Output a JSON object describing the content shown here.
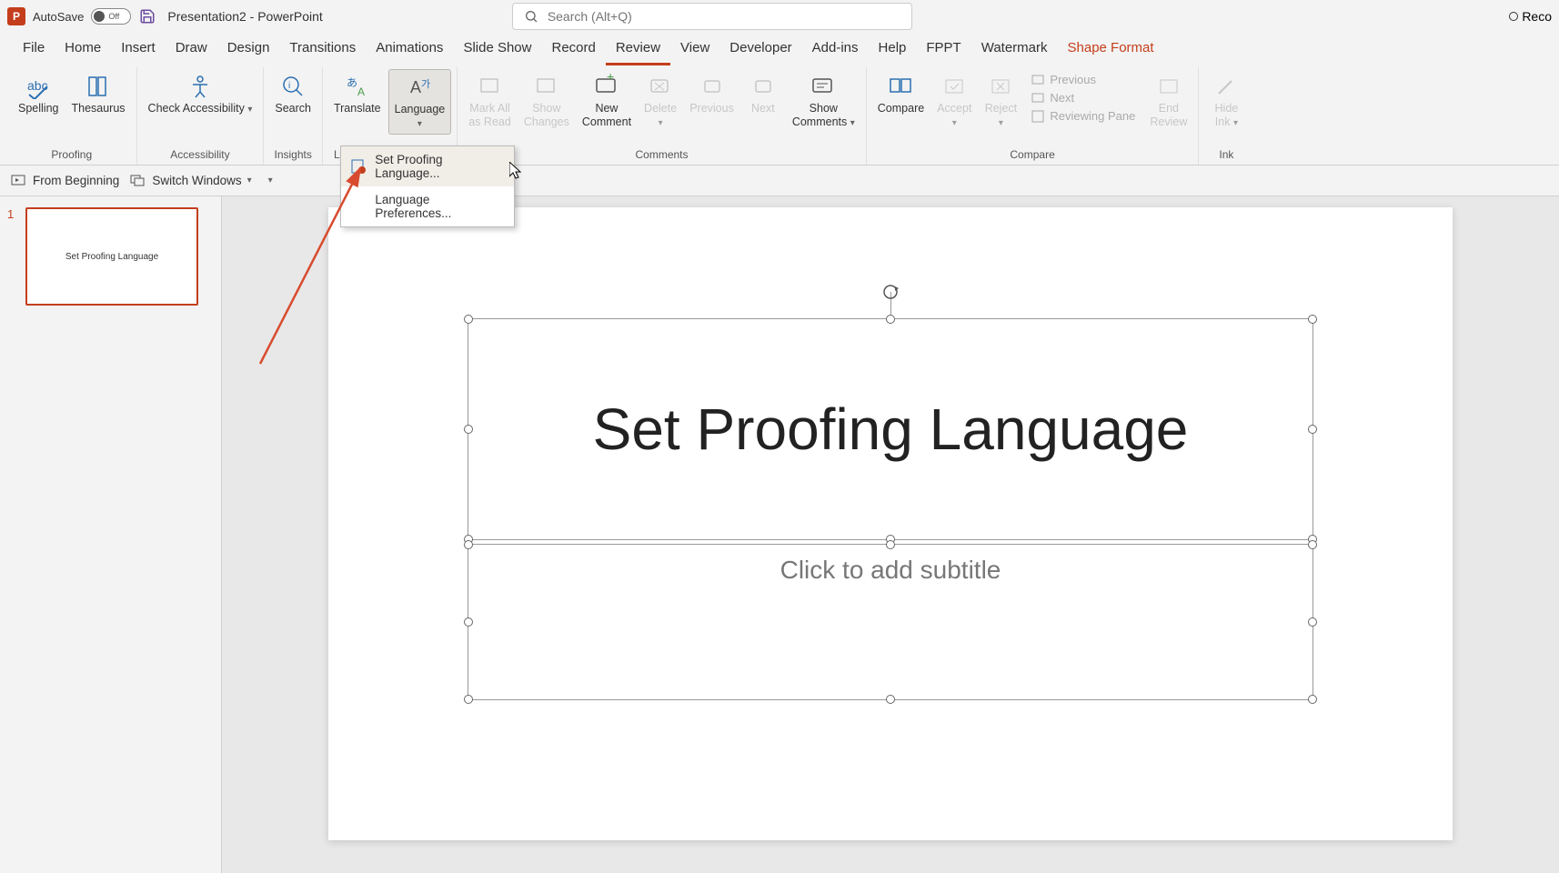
{
  "titleBar": {
    "autoSaveLabel": "AutoSave",
    "autoSaveState": "Off",
    "documentTitle": "Presentation2  -  PowerPoint",
    "searchPlaceholder": "Search (Alt+Q)",
    "recordLabel": "Reco"
  },
  "tabs": [
    "File",
    "Home",
    "Insert",
    "Draw",
    "Design",
    "Transitions",
    "Animations",
    "Slide Show",
    "Record",
    "Review",
    "View",
    "Developer",
    "Add-ins",
    "Help",
    "FPPT",
    "Watermark",
    "Shape Format"
  ],
  "activeTab": "Review",
  "ribbon": {
    "proofing": {
      "label": "Proofing",
      "spelling": "Spelling",
      "thesaurus": "Thesaurus"
    },
    "accessibility": {
      "label": "Accessibility",
      "check": "Check\nAccessibility"
    },
    "insights": {
      "label": "Insights",
      "search": "Search"
    },
    "language": {
      "label": "Lang",
      "translate": "Translate",
      "languageBtn": "Language"
    },
    "comments": {
      "label": "Comments",
      "markAll": "Mark All\nas Read",
      "showChanges": "Show\nChanges",
      "newComment": "New\nComment",
      "delete": "Delete",
      "previous": "Previous",
      "next": "Next",
      "showComments": "Show\nComments"
    },
    "compare": {
      "label": "Compare",
      "compare": "Compare",
      "accept": "Accept",
      "reject": "Reject",
      "prev2": "Previous",
      "next2": "Next",
      "revPane": "Reviewing Pane",
      "endReview": "End\nReview"
    },
    "ink": {
      "label": "Ink",
      "hideInk": "Hide\nInk"
    }
  },
  "qat2": {
    "fromBeginning": "From Beginning",
    "switchWindows": "Switch Windows"
  },
  "dropdown": {
    "item1": "Set Proofing Language...",
    "item2": "Language Preferences..."
  },
  "thumb": {
    "num": "1",
    "title": "Set Proofing Language"
  },
  "slide": {
    "title": "Set Proofing Language",
    "subtitle": "Click to add subtitle"
  }
}
